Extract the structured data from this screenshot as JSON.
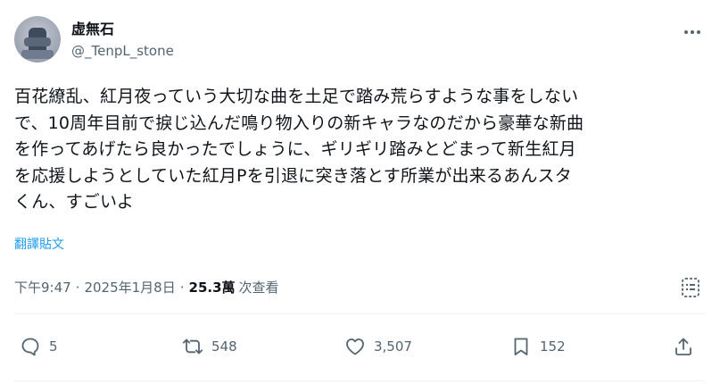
{
  "author": {
    "display_name": "虚無石",
    "handle": "@_TenpL_stone"
  },
  "tweet": {
    "lines": [
      "百花繚乱、紅月夜っていう大切な曲を土足で踏み荒らすような事をしない",
      "で、10周年目前で捩じ込んだ鳴り物入りの新キャラなのだから豪華な新曲",
      "を作ってあげたら良かったでしょうに、ギリギリ踏みとどまって新生紅月",
      "を応援しようとしていた紅月Pを引退に突き落とす所業が出来るあんスタ",
      "くん、すごいよ"
    ],
    "translate_label": "翻譯貼文",
    "time": "下午9:47",
    "date": "2025年1月8日",
    "views_count": "25.3萬",
    "views_label": "次查看"
  },
  "actions": {
    "replies": "5",
    "retweets": "548",
    "likes": "3,507",
    "bookmarks": "152"
  },
  "icons": {
    "more": "more-icon",
    "stats": "stats-icon",
    "reply": "reply-icon",
    "retweet": "retweet-icon",
    "like": "heart-icon",
    "bookmark": "bookmark-icon",
    "share": "share-icon"
  },
  "colors": {
    "text": "#0f1419",
    "secondary": "#536471",
    "link": "#1d9bf0",
    "divider": "#eff3f4"
  }
}
